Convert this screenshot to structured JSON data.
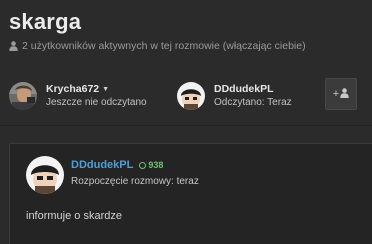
{
  "conversation": {
    "title": "skarga",
    "active_users": "2 użytkowników aktywnych w tej rozmowie (włączając ciebie)"
  },
  "participants": [
    {
      "name": "Krycha672",
      "status": "Jeszcze nie odczytano",
      "has_menu": true
    },
    {
      "name": "DDdudekPL",
      "status": "Odczytano: Teraz",
      "has_menu": false
    }
  ],
  "invite_button": {
    "icon": "add-user-icon",
    "label": "+"
  },
  "message": {
    "author": "DDdudekPL",
    "reputation": "938",
    "meta": "Rozpoczęcie rozmowy: teraz",
    "body": "informuje o skardze"
  },
  "colors": {
    "background": "#2b2b2b",
    "author_link": "#4aa0d8",
    "reputation": "#6cc36c"
  }
}
